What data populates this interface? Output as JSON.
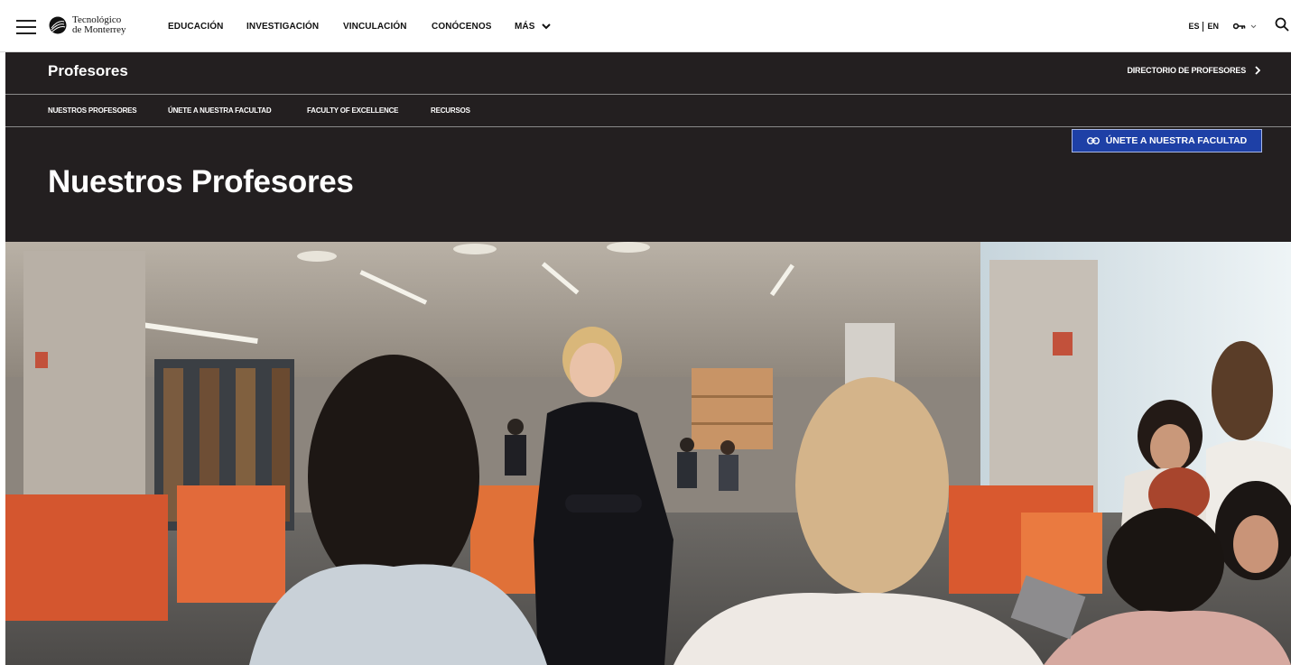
{
  "header": {
    "logo": {
      "line1": "Tecnológico",
      "line2": "de Monterrey"
    },
    "nav": [
      {
        "label": "EDUCACIÓN"
      },
      {
        "label": "INVESTIGACIÓN"
      },
      {
        "label": "VINCULACIÓN"
      },
      {
        "label": "CONÓCENOS"
      },
      {
        "label": "MÁS"
      }
    ],
    "lang": {
      "es": "ES",
      "en": "EN"
    },
    "icons": {
      "menu": "hamburger-icon",
      "login": "key-icon",
      "search": "search-icon"
    }
  },
  "section": {
    "title": "Profesores",
    "directory_link": "DIRECTORIO DE PROFESORES",
    "subnav": [
      {
        "label": "NUESTROS PROFESORES"
      },
      {
        "label": "ÚNETE A NUESTRA FACULTAD"
      },
      {
        "label": "FACULTY OF EXCELLENCE"
      },
      {
        "label": "RECURSOS"
      }
    ],
    "cta": {
      "label": "ÚNETE A NUESTRA FACULTAD",
      "icon": "link-icon"
    }
  },
  "page": {
    "title": "Nuestros Profesores"
  },
  "colors": {
    "dark_bg": "#231f20",
    "cta_bg": "#1e40a6",
    "white": "#ffffff"
  }
}
